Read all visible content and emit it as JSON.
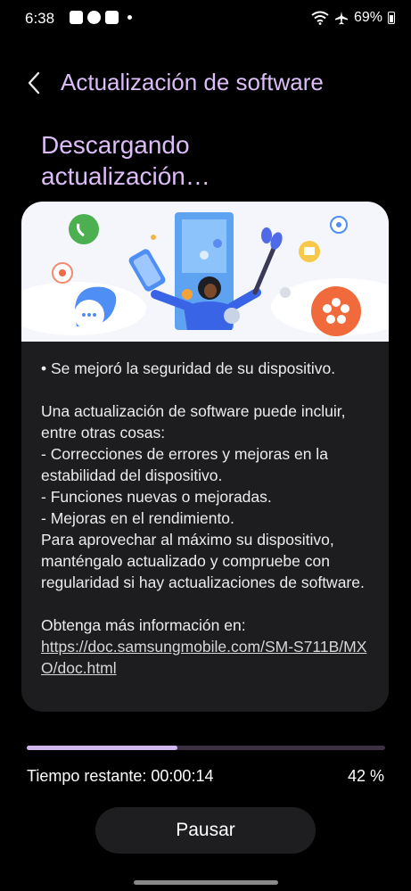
{
  "status_bar": {
    "time": "6:38",
    "battery": "69%",
    "icons": [
      "notification-icon",
      "whatsapp-icon",
      "youtube-icon",
      "wifi-icon",
      "airplane-icon",
      "battery-icon"
    ]
  },
  "header": {
    "title": "Actualización de software",
    "back_icon": "chevron-left-icon"
  },
  "heading": "Descargando actualización…",
  "card": {
    "bullet": "• Se mejoró la seguridad de su dispositivo.",
    "description": "Una actualización de software puede incluir, entre otras cosas:\n - Correcciones de errores y mejoras en la estabilidad del dispositivo.\n - Funciones nuevas o mejoradas.\n - Mejoras en el rendimiento.\nPara aprovechar al máximo su dispositivo, manténgalo actualizado y compruebe con regularidad si hay actualizaciones de software.",
    "more_info": "Obtenga más información en:",
    "link": "https://doc.samsungmobile.com/SM-S711B/MXO/doc.html"
  },
  "progress": {
    "fraction": 0.42,
    "time_remaining": "Tiempo restante: 00:00:14",
    "percent": "42 %"
  },
  "actions": {
    "pause": "Pausar"
  },
  "colors": {
    "accent": "#dcbdf8",
    "progress_fill": "#d2b6ee",
    "card_bg": "#1d1d1f"
  }
}
